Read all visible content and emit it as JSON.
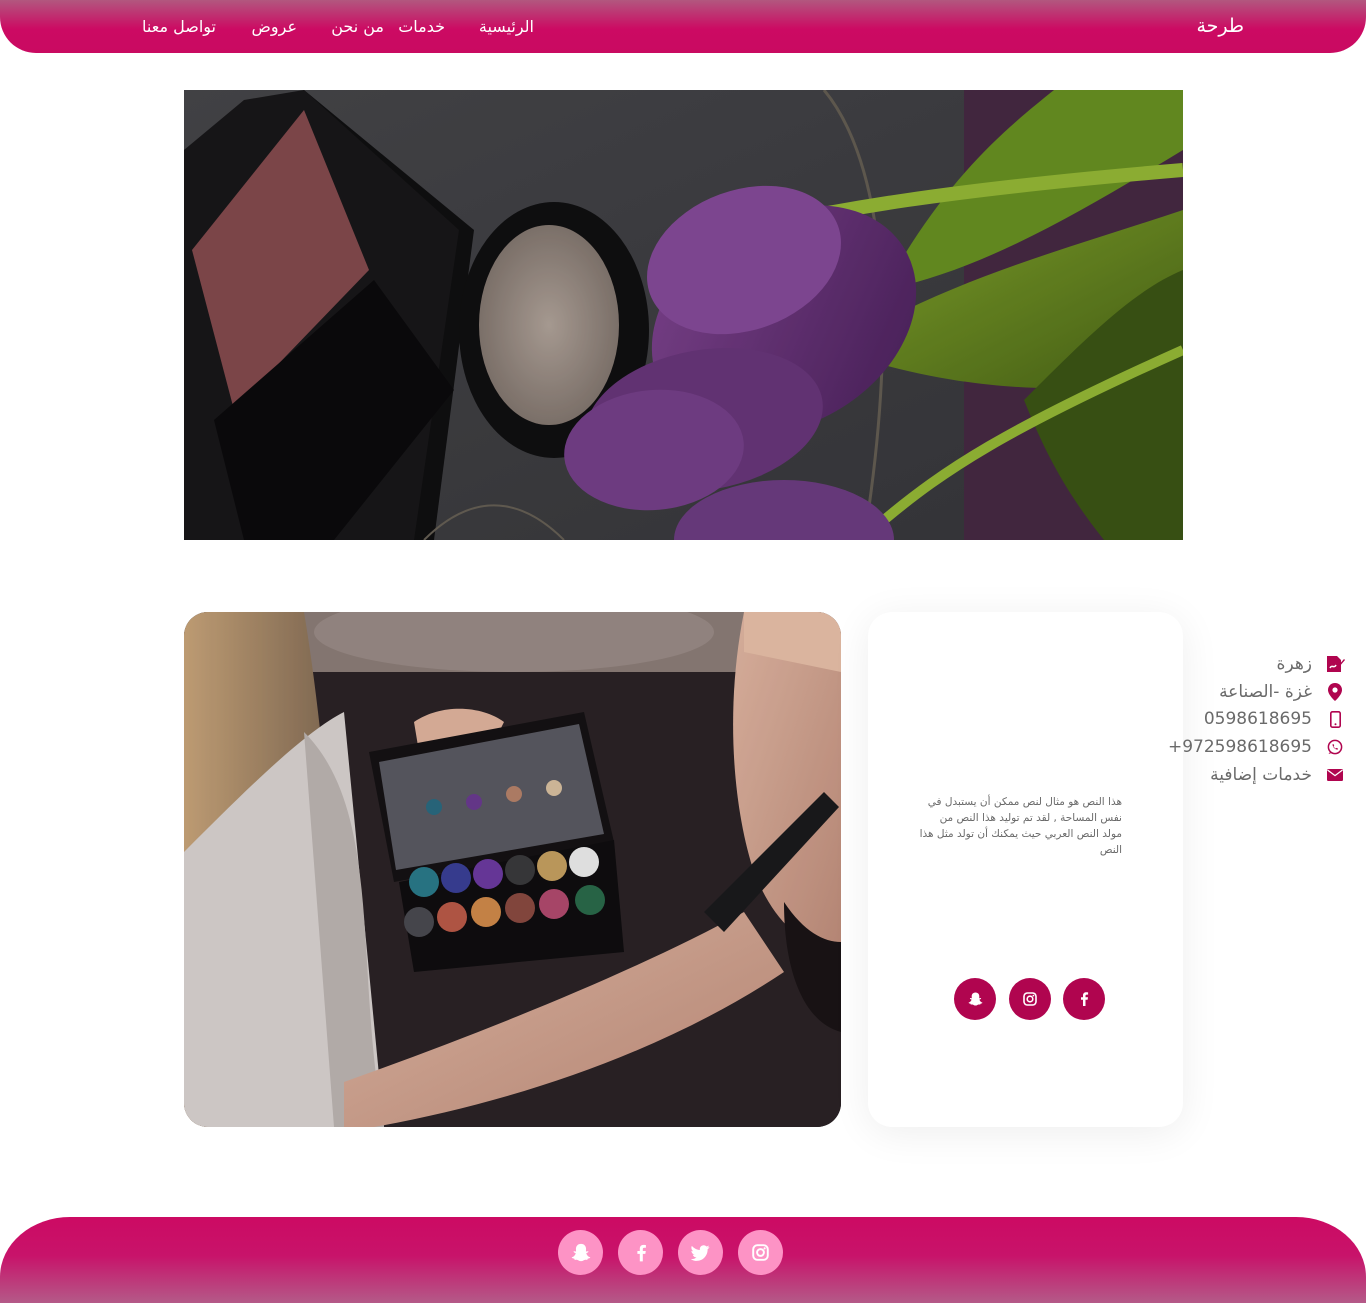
{
  "header": {
    "brand": "طرحة",
    "nav": {
      "home": "الرئيسية",
      "services": "خدمات",
      "about": "من نحن",
      "offers": "عروض",
      "contact": "تواصل معنا"
    }
  },
  "info": {
    "name": "زهرة",
    "location": "غزة -الصناعة",
    "phone": "0598618695",
    "whatsapp": "+972598618695",
    "extra_services": "خدمات إضافية",
    "description": "هذا النص هو مثال لنص ممكن أن يستبدل في نفس المساحة , لقد تم توليد هذا النص من مولد النص العربي حيث يمكنك أن تولد مثل هذا النص"
  },
  "icons": {
    "name": "signature-icon",
    "location": "map-marker-icon",
    "phone": "mobile-phone-icon",
    "whatsapp": "whatsapp-icon",
    "email": "envelope-icon",
    "facebook": "facebook-icon",
    "instagram": "instagram-icon",
    "snapchat": "snapchat-icon",
    "twitter": "twitter-icon"
  },
  "colors": {
    "brand_pink": "#cc0a63",
    "icon_crimson": "#b0054f",
    "footer_icon_bg": "#fd93c5"
  }
}
